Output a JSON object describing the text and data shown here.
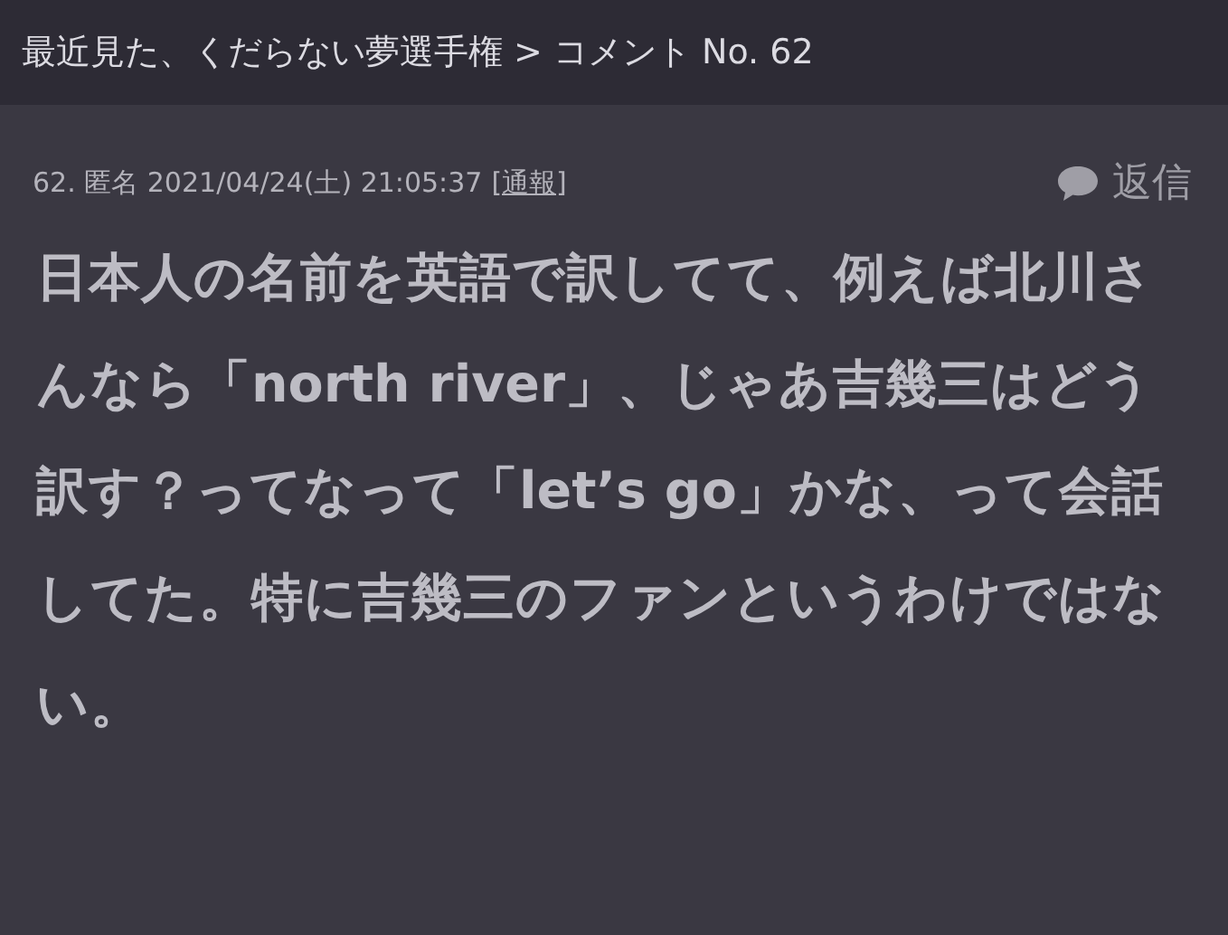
{
  "header": {
    "breadcrumb": "最近見た、くだらない夢選手権 > コメント No. 62"
  },
  "comment": {
    "meta": "62. 匿名 2021/04/24(土) 21:05:37",
    "report_link": "[通報]",
    "reply_button": "返信",
    "body": "日本人の名前を英語で訳してて、例えば北川さんなら「north river」、じゃあ吉幾三はどう訳す？ってなって「let’s go」かな、って会話してた。特に吉幾三のファンというわけではない。"
  }
}
